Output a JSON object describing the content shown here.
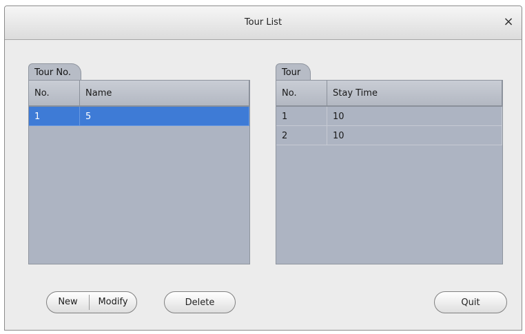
{
  "dialog": {
    "title": "Tour List",
    "close_glyph": "×"
  },
  "tour_no_panel": {
    "tab_label": "Tour No.",
    "columns": [
      "No.",
      "Name"
    ],
    "rows": [
      {
        "no": "1",
        "name": "5",
        "selected": true
      }
    ]
  },
  "tour_panel": {
    "tab_label": "Tour",
    "columns": [
      "No.",
      "Stay Time"
    ],
    "rows": [
      {
        "no": "1",
        "stay_time": "10"
      },
      {
        "no": "2",
        "stay_time": "10"
      }
    ]
  },
  "buttons": {
    "new": "New",
    "modify": "Modify",
    "delete": "Delete",
    "quit": "Quit"
  },
  "colors": {
    "selection": "#3e7bd6",
    "grid_bg": "#adb4c2",
    "dialog_bg": "#ececec"
  }
}
